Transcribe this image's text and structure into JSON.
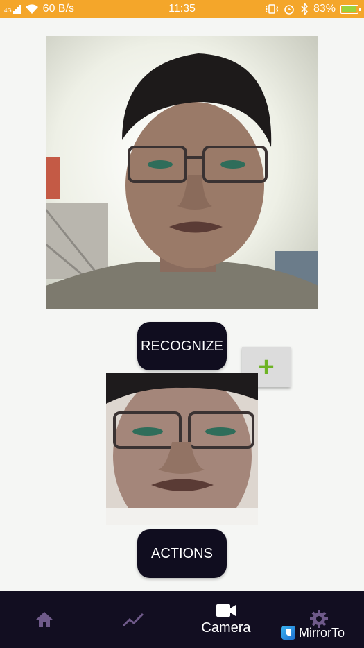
{
  "status_bar": {
    "network": "4G",
    "speed": "60 B/s",
    "time": "11:35",
    "battery": "83%",
    "battery_level": 0.83
  },
  "main": {
    "recognize_label": "RECOGNIZE",
    "add_label": "+",
    "actions_label": "ACTIONS"
  },
  "bottom_nav": {
    "items": [
      {
        "icon": "home-icon",
        "label": ""
      },
      {
        "icon": "trending-icon",
        "label": ""
      },
      {
        "icon": "camera-icon",
        "label": "Camera"
      },
      {
        "icon": "settings-icon",
        "label": ""
      }
    ],
    "active_color": "#ffffff",
    "inactive_color": "#6f5a8a"
  },
  "watermark": {
    "text": "MirrorTo"
  },
  "colors": {
    "status_bar": "#f4a62a",
    "button_bg": "#100d1f",
    "nav_bg": "#120e21",
    "add_plus": "#6db324"
  }
}
